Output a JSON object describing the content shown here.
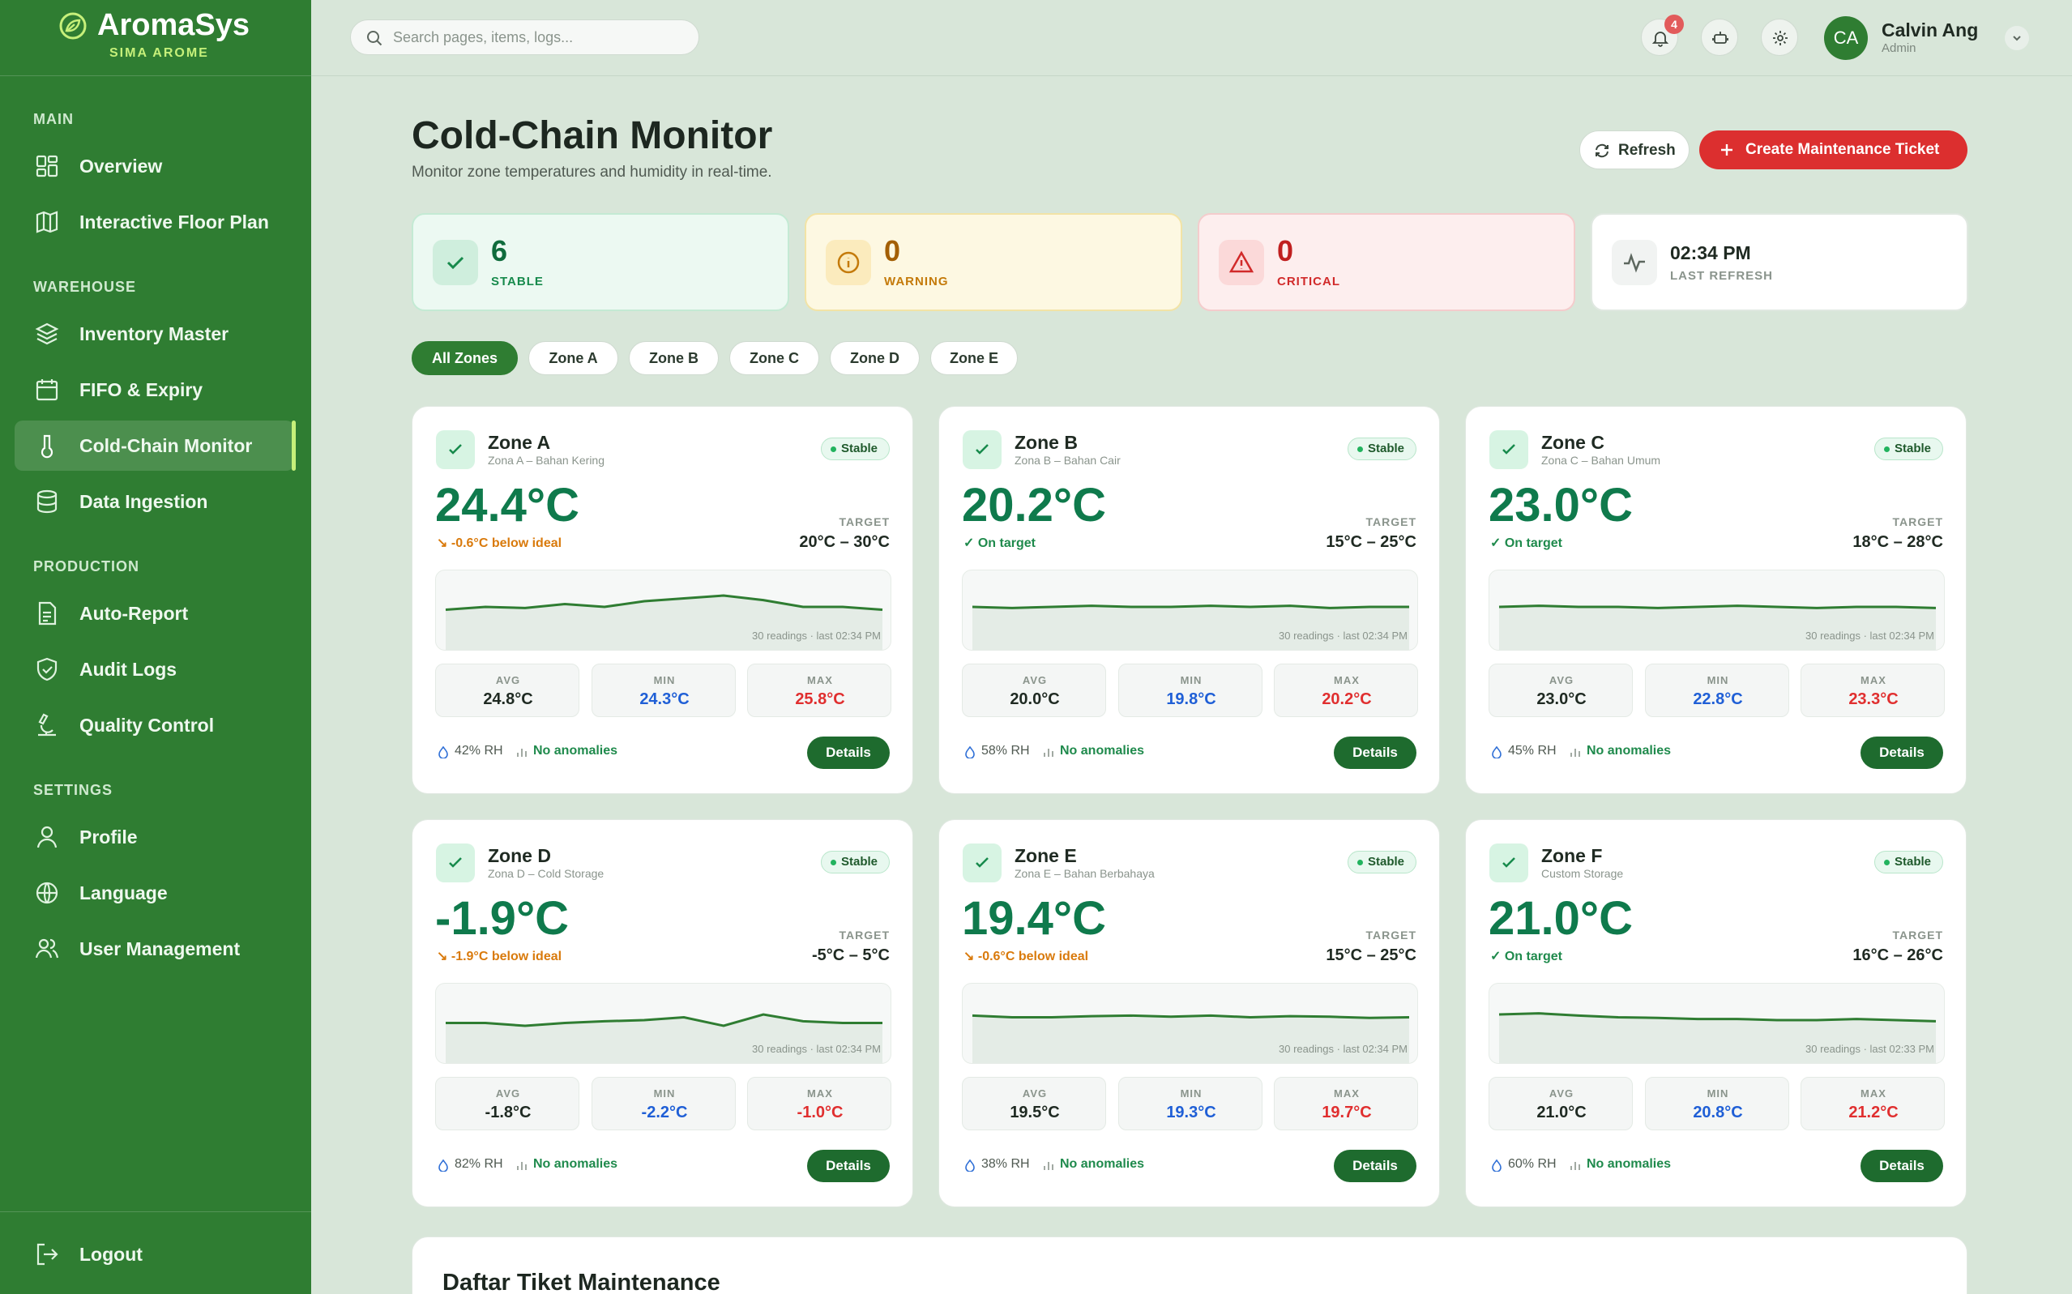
{
  "brand": {
    "name": "AromaSys",
    "subtitle": "SIMA AROME"
  },
  "sidebar": {
    "sections": {
      "main": "MAIN",
      "warehouse": "WAREHOUSE",
      "production": "PRODUCTION",
      "settings": "SETTINGS"
    },
    "items": {
      "overview": "Overview",
      "floorplan": "Interactive Floor Plan",
      "inventory": "Inventory Master",
      "fifo": "FIFO & Expiry",
      "coldchain": "Cold-Chain Monitor",
      "ingestion": "Data Ingestion",
      "autoreport": "Auto-Report",
      "audit": "Audit Logs",
      "quality": "Quality Control",
      "profile": "Profile",
      "language": "Language",
      "users": "User Management"
    },
    "logout": "Logout",
    "accent": "#c6f07a"
  },
  "topbar": {
    "search_placeholder": "Search pages, items, logs...",
    "notif_count": "4",
    "user_name": "Calvin Ang",
    "user_role": "Admin",
    "avatar_initials": "CA"
  },
  "page": {
    "title": "Cold-Chain Monitor",
    "subtitle": "Monitor zone temperatures and humidity in real-time.",
    "refresh": "Refresh",
    "create_ticket": "Create Maintenance Ticket"
  },
  "stats": {
    "stable": {
      "value": "6",
      "label": "STABLE"
    },
    "warning": {
      "value": "0",
      "label": "WARNING"
    },
    "critical": {
      "value": "0",
      "label": "CRITICAL"
    },
    "refresh": {
      "value": "02:34 PM",
      "label": "LAST REFRESH"
    }
  },
  "tabs": [
    "All Zones",
    "Zone A",
    "Zone B",
    "Zone C",
    "Zone D",
    "Zone E"
  ],
  "zones": [
    {
      "name": "Zone A",
      "sub": "Zona A – Bahan Kering",
      "status": "Stable",
      "temp": "24.4°C",
      "note": "-0.6°C below ideal",
      "note_type": "off",
      "target_label": "TARGET",
      "target": "20°C – 30°C",
      "readings": "30 readings · last 02:34 PM",
      "avg": "24.8°C",
      "min": "24.3°C",
      "max": "25.8°C",
      "rh": "42% RH",
      "anomalies": "No anomalies",
      "details": "Details",
      "spark": [
        0.55,
        0.5,
        0.52,
        0.45,
        0.5,
        0.4,
        0.35,
        0.3,
        0.38,
        0.5,
        0.5,
        0.55
      ]
    },
    {
      "name": "Zone B",
      "sub": "Zona B – Bahan Cair",
      "status": "Stable",
      "temp": "20.2°C",
      "note": "On target",
      "note_type": "on",
      "target_label": "TARGET",
      "target": "15°C – 25°C",
      "readings": "30 readings · last 02:34 PM",
      "avg": "20.0°C",
      "min": "19.8°C",
      "max": "20.2°C",
      "rh": "58% RH",
      "anomalies": "No anomalies",
      "details": "Details",
      "spark": [
        0.5,
        0.52,
        0.5,
        0.48,
        0.5,
        0.5,
        0.48,
        0.5,
        0.48,
        0.52,
        0.5,
        0.5
      ]
    },
    {
      "name": "Zone C",
      "sub": "Zona C – Bahan Umum",
      "status": "Stable",
      "temp": "23.0°C",
      "note": "On target",
      "note_type": "on",
      "target_label": "TARGET",
      "target": "18°C – 28°C",
      "readings": "30 readings · last 02:34 PM",
      "avg": "23.0°C",
      "min": "22.8°C",
      "max": "23.3°C",
      "rh": "45% RH",
      "anomalies": "No anomalies",
      "details": "Details",
      "spark": [
        0.5,
        0.48,
        0.5,
        0.5,
        0.52,
        0.5,
        0.48,
        0.5,
        0.52,
        0.5,
        0.5,
        0.52
      ]
    },
    {
      "name": "Zone D",
      "sub": "Zona D – Cold Storage",
      "status": "Stable",
      "temp": "-1.9°C",
      "note": "-1.9°C below ideal",
      "note_type": "off",
      "target_label": "TARGET",
      "target": "-5°C – 5°C",
      "readings": "30 readings · last 02:34 PM",
      "avg": "-1.8°C",
      "min": "-2.2°C",
      "max": "-1.0°C",
      "rh": "82% RH",
      "anomalies": "No anomalies",
      "details": "Details",
      "spark": [
        0.55,
        0.55,
        0.6,
        0.55,
        0.52,
        0.5,
        0.45,
        0.6,
        0.4,
        0.52,
        0.55,
        0.55
      ]
    },
    {
      "name": "Zone E",
      "sub": "Zona E – Bahan Berbahaya",
      "status": "Stable",
      "temp": "19.4°C",
      "note": "-0.6°C below ideal",
      "note_type": "off",
      "target_label": "TARGET",
      "target": "15°C – 25°C",
      "readings": "30 readings · last 02:34 PM",
      "avg": "19.5°C",
      "min": "19.3°C",
      "max": "19.7°C",
      "rh": "38% RH",
      "anomalies": "No anomalies",
      "details": "Details",
      "spark": [
        0.42,
        0.45,
        0.45,
        0.43,
        0.42,
        0.44,
        0.42,
        0.45,
        0.43,
        0.44,
        0.46,
        0.45
      ]
    },
    {
      "name": "Zone F",
      "sub": "Custom Storage",
      "status": "Stable",
      "temp": "21.0°C",
      "note": "On target",
      "note_type": "on",
      "target_label": "TARGET",
      "target": "16°C – 26°C",
      "readings": "30 readings · last 02:33 PM",
      "avg": "21.0°C",
      "min": "20.8°C",
      "max": "21.2°C",
      "rh": "60% RH",
      "anomalies": "No anomalies",
      "details": "Details",
      "spark": [
        0.4,
        0.38,
        0.42,
        0.45,
        0.46,
        0.48,
        0.48,
        0.5,
        0.5,
        0.48,
        0.5,
        0.52
      ]
    }
  ],
  "metric_labels": {
    "avg": "AVG",
    "min": "MIN",
    "max": "MAX"
  },
  "ticket_section": {
    "title": "Daftar Tiket Maintenance"
  },
  "colors": {
    "primary": "#2f7d32",
    "danger": "#dc2f2f",
    "temp_green": "#0f7a4c",
    "min_blue": "#1f5fd6",
    "max_red": "#e02f2f"
  }
}
